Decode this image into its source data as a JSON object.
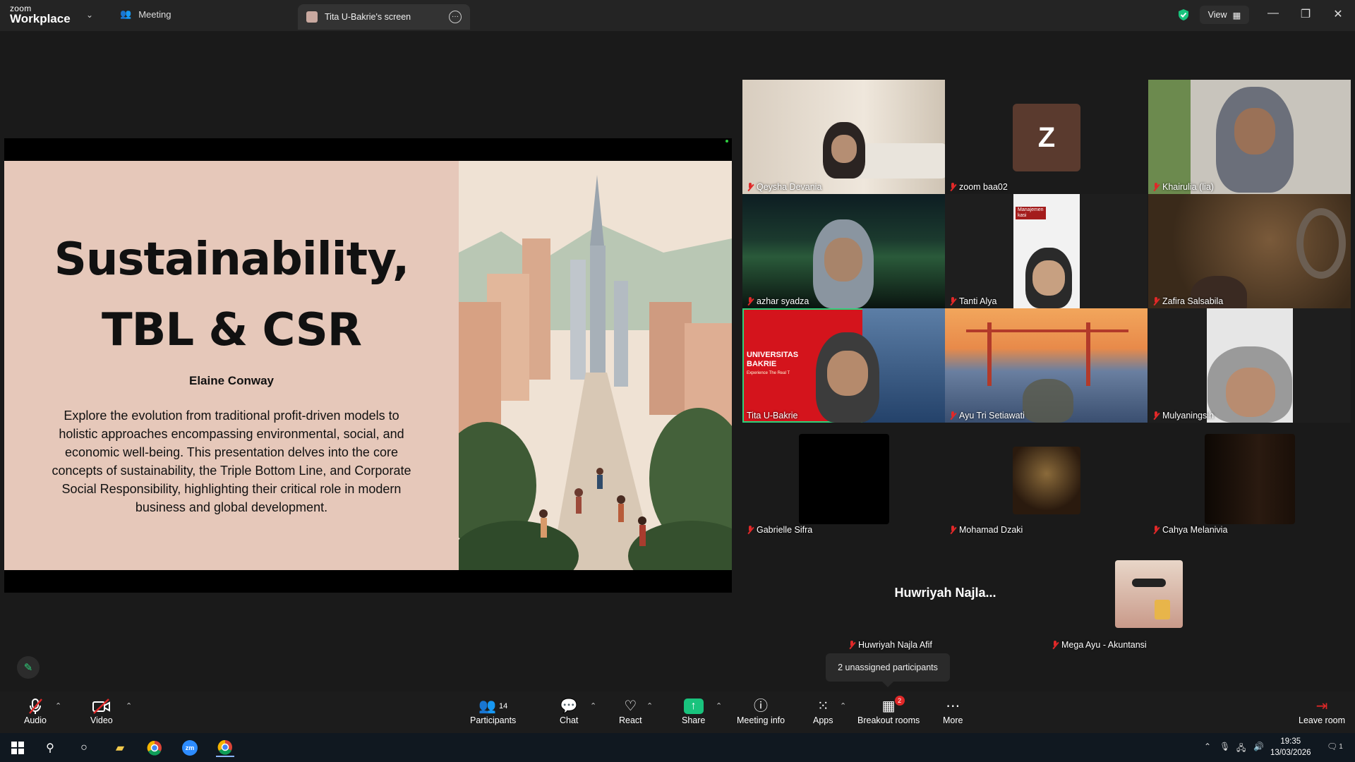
{
  "app": {
    "logo_line1": "zoom",
    "logo_line2": "Workplace",
    "meeting_tab": "Meeting",
    "screen_tab": "Tita U-Bakrie's screen",
    "view_label": "View"
  },
  "slide": {
    "title_line1": "Sustainability,",
    "title_line2": "TBL & CSR",
    "author": "Elaine Conway",
    "body": "Explore the evolution from traditional profit-driven models to holistic approaches encompassing environmental, social, and economic well-being. This presentation delves into the core concepts of sustainability, the Triple Bottom Line, and Corporate Social Responsibility, highlighting their critical role in modern business and global development."
  },
  "participants": [
    {
      "name": "Qeysha Devania"
    },
    {
      "name": "zoom baa02",
      "initial": "Z"
    },
    {
      "name": "Khairulia (lia)"
    },
    {
      "name": "azhar syadza"
    },
    {
      "name": "Tanti Alya",
      "overlay_text": "Manajemen\nkasi"
    },
    {
      "name": "Zafira Salsabila"
    },
    {
      "name": "Tita U-Bakrie",
      "overlay_text": "UNIVERSITAS\nBAKRIE",
      "overlay_sub": "Experience The Real T"
    },
    {
      "name": "Ayu Tri Setiawati"
    },
    {
      "name": "Mulyaningsih"
    },
    {
      "name": "Gabrielle Sifra"
    },
    {
      "name": "Mohamad Dzaki"
    },
    {
      "name": "Cahya Melanivia"
    },
    {
      "name": "Huwriyah Najla Afif",
      "display": "Huwriyah  Najla..."
    },
    {
      "name": "Mega Ayu - Akuntansi"
    }
  ],
  "tooltip": "2 unassigned participants",
  "toolbar": {
    "audio": "Audio",
    "video": "Video",
    "participants": "Participants",
    "participants_count": "14",
    "chat": "Chat",
    "react": "React",
    "share": "Share",
    "meeting_info": "Meeting info",
    "apps": "Apps",
    "breakout": "Breakout rooms",
    "breakout_badge": "2",
    "more": "More",
    "leave": "Leave room"
  },
  "taskbar": {
    "time": "19:35",
    "date": "13/03/2026",
    "notif_count": "1"
  },
  "colors": {
    "accent_green": "#19c37d",
    "active_speaker": "#2fd07a",
    "muted_red": "#e02828"
  }
}
